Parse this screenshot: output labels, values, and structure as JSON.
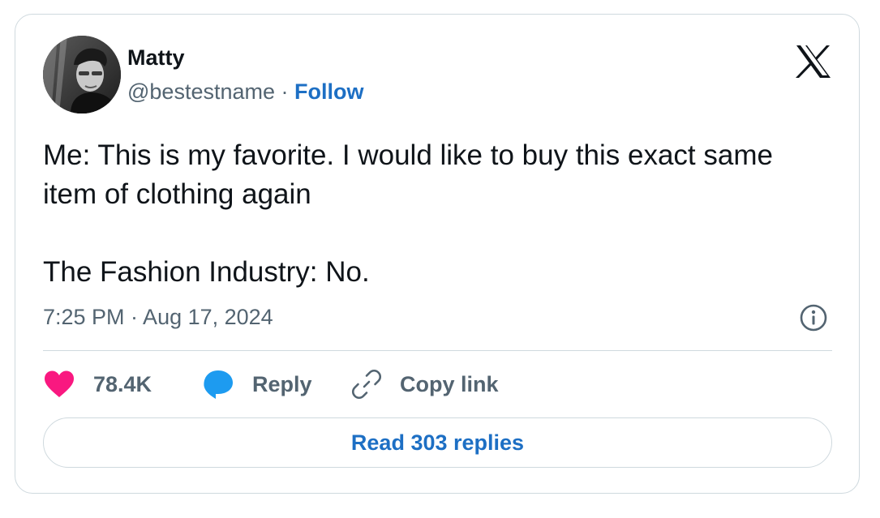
{
  "author": {
    "name": "Matty",
    "handle": "@bestestname",
    "separator": "·",
    "follow_label": "Follow"
  },
  "tweet": {
    "line1": "Me: This is my favorite. I would like to buy this exact same item of clothing again",
    "line2": "The Fashion Industry: No.",
    "timestamp": "7:25 PM · Aug 17, 2024"
  },
  "actions": {
    "like_count": "78.4K",
    "reply_label": "Reply",
    "copy_label": "Copy link"
  },
  "footer": {
    "read_replies_label": "Read 303 replies"
  },
  "colors": {
    "like": "#f91880",
    "reply": "#1d9bf0",
    "link": "#1d6fc4",
    "muted": "#536471"
  },
  "icons": {
    "platform": "x-logo-icon",
    "info": "info-icon",
    "like": "heart-icon",
    "reply": "speech-bubble-icon",
    "copy": "link-icon"
  }
}
